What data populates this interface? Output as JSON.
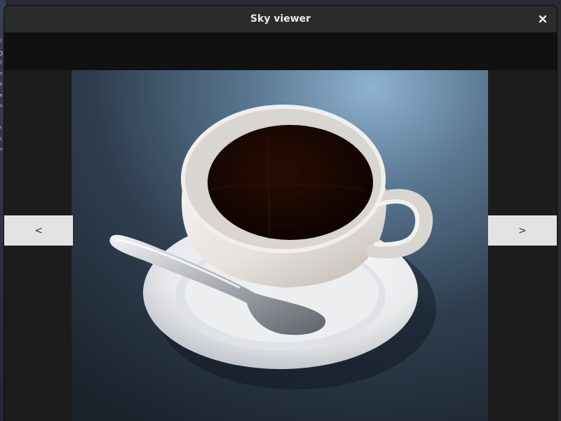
{
  "window": {
    "title": "Sky viewer"
  },
  "icons": {
    "close": "close-icon"
  },
  "navigation": {
    "prev_label": "<",
    "next_label": ">"
  },
  "colors": {
    "titlebar": "#2b2b2b",
    "toolbar": "#111111",
    "stage": "#1c1c1c",
    "nav_button": "#e3e3e3"
  }
}
